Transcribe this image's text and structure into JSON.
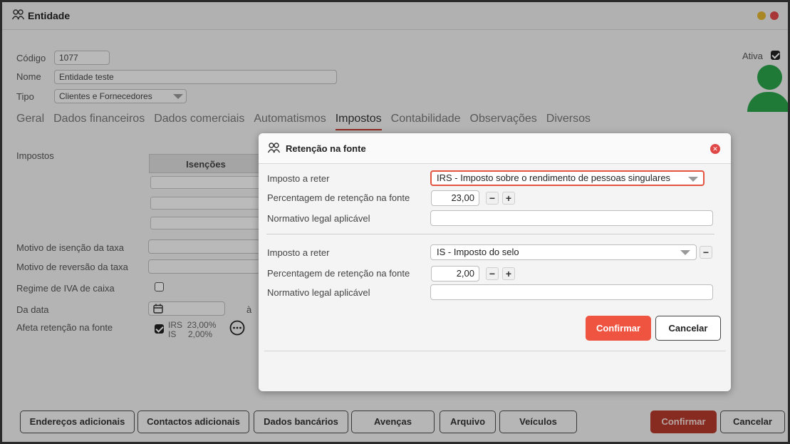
{
  "window": {
    "title": "Entidade",
    "icon": "users-icon"
  },
  "form": {
    "codigo_label": "Código",
    "codigo_value": "1077",
    "nome_label": "Nome",
    "nome_value": "Entidade teste",
    "tipo_label": "Tipo",
    "tipo_value": "Clientes e Fornecedores",
    "ativa_label": "Ativa"
  },
  "tabs": [
    "Geral",
    "Dados financeiros",
    "Dados comerciais",
    "Automatismos",
    "Impostos",
    "Contabilidade",
    "Observações",
    "Diversos"
  ],
  "impostos": {
    "section_label": "Impostos",
    "isencoes_header": "Isenções",
    "motivo_isencao_label": "Motivo de isenção da taxa",
    "motivo_reversao_label": "Motivo de reversão da taxa",
    "regime_iva_label": "Regime de IVA de caixa",
    "da_data_label": "Da data",
    "a_label": "à",
    "afeta_retencao_label": "Afeta retenção na fonte",
    "retencao_line1": "IRS  23,00%",
    "retencao_line2": "IS     2,00%"
  },
  "bottom_buttons": [
    "Endereços adicionais",
    "Contactos adicionais",
    "Dados bancários",
    "Avenças",
    "Arquivo",
    "Veículos"
  ],
  "bottom_confirm": "Confirmar",
  "bottom_cancel": "Cancelar",
  "dialog": {
    "title": "Retenção na fonte",
    "row1": {
      "imposto_label": "Imposto a reter",
      "imposto_value": "IRS - Imposto sobre o rendimento de pessoas singulares",
      "percent_label": "Percentagem de retenção na fonte",
      "percent_value": "23,00",
      "normativo_label": "Normativo legal aplicável"
    },
    "row2": {
      "imposto_label": "Imposto a reter",
      "imposto_value": "IS - Imposto do selo",
      "percent_label": "Percentagem de retenção na fonte",
      "percent_value": "2,00",
      "normativo_label": "Normativo legal aplicável"
    },
    "minus": "−",
    "plus": "+",
    "confirm": "Confirmar",
    "cancel": "Cancelar"
  },
  "colors": {
    "accent_red": "#ef5440",
    "active_tab_underline": "#c0392b",
    "avatar_green": "#2aa34a"
  }
}
